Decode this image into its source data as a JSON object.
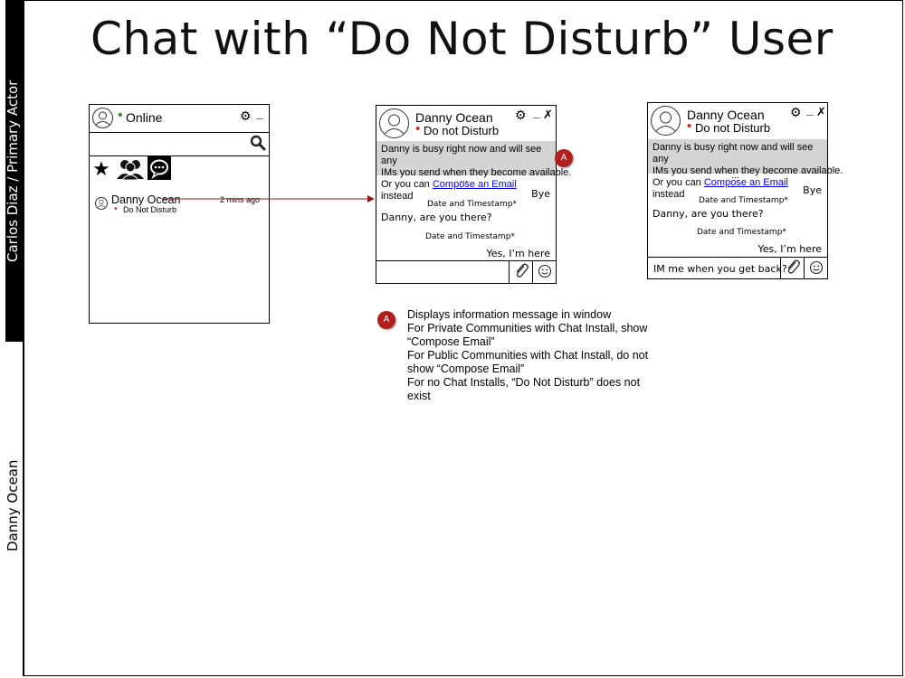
{
  "lanes": {
    "primary": "Carlos Diaz / Primary Actor",
    "secondary": "Danny Ocean"
  },
  "title": "Chat with “Do Not Disturb” User",
  "contacts_window": {
    "presence_dot": "•",
    "status_label": "Online",
    "status_color": "#2e8b2e",
    "contact": {
      "name": "Danny Ocean",
      "status_dot": "•",
      "status": "Do Not Disturb",
      "time": "2 mins ago"
    },
    "icons": [
      "avatar-icon",
      "gear-icon",
      "minimize-icon",
      "search-icon",
      "star-icon",
      "group-icon",
      "chat-icon"
    ]
  },
  "chat_window_1": {
    "contact_name": "Danny Ocean",
    "status_dot": "•",
    "status": "Do not Disturb",
    "status_color": "#d02020",
    "info_line1": "Danny is busy right now and will see any",
    "info_line2": "IMs you send when they become available.",
    "info_line3_prefix": "Or you can ",
    "info_link": "Compose an Email",
    "info_line3_suffix": " instead",
    "badge": "A",
    "ellipsis": "…",
    "msg_bye": "Bye",
    "timestamp1": "Date and Timestamp*",
    "msg_question": "Danny, are you there?",
    "timestamp2": "Date and Timestamp*",
    "msg_reply": "Yes, I’m here",
    "input_value": ""
  },
  "chat_window_2": {
    "contact_name": "Danny Ocean",
    "status_dot": "•",
    "status": "Do not Disturb",
    "info_line1": "Danny is busy right now and will see any",
    "info_line2": "IMs you send when they become available.",
    "info_line3_prefix": "Or you can ",
    "info_link": "Compose an Email",
    "info_line3_suffix": " instead",
    "ellipsis": "…",
    "msg_bye": "Bye",
    "timestamp1": "Date and Timestamp*",
    "msg_question": "Danny, are you there?",
    "timestamp2": "Date and Timestamp*",
    "msg_reply": "Yes, I’m here",
    "input_value": "IM me when you get back?"
  },
  "annotation": {
    "badge": "A",
    "lines": [
      "Displays information message in window",
      "For Private Communities with Chat Install, show “Compose Email”",
      "For Public Communities with Chat Install, do not show “Compose Email”",
      "For no Chat Installs, “Do Not Disturb” does not exist"
    ]
  },
  "colors": {
    "arrow": "#8b1a1a",
    "badge": "#b01e1e",
    "info_bg": "#d4d4d4",
    "link": "#0000ee"
  }
}
